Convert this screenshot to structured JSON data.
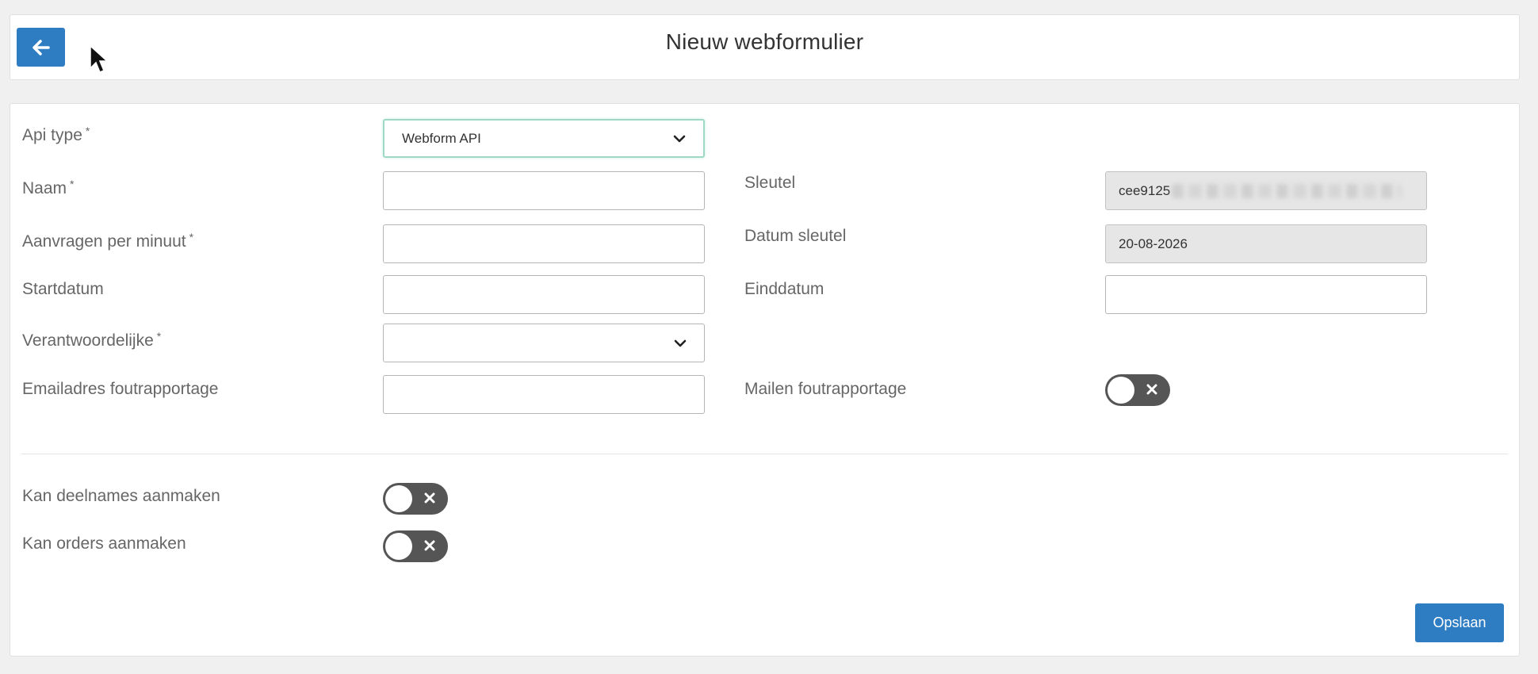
{
  "header": {
    "title": "Nieuw webformulier",
    "back_icon": "arrow-left-icon"
  },
  "form": {
    "api_type": {
      "label": "Api type",
      "required": "*",
      "value": "Webform API"
    },
    "naam": {
      "label": "Naam",
      "required": "*",
      "value": ""
    },
    "aanvragen": {
      "label": "Aanvragen per minuut",
      "required": "*",
      "value": ""
    },
    "startdatum": {
      "label": "Startdatum",
      "value": ""
    },
    "verantwoordelijke": {
      "label": "Verantwoordelijke",
      "required": "*",
      "value": ""
    },
    "emailadres": {
      "label": "Emailadres foutrapportage",
      "value": ""
    },
    "sleutel": {
      "label": "Sleutel",
      "value": "cee9125"
    },
    "datum_sleutel": {
      "label": "Datum sleutel",
      "value": "20-08-2026"
    },
    "einddatum": {
      "label": "Einddatum",
      "value": ""
    },
    "mailen": {
      "label": "Mailen foutrapportage",
      "state": "off"
    },
    "deelnames": {
      "label": "Kan deelnames aanmaken",
      "state": "off"
    },
    "orders": {
      "label": "Kan orders aanmaken",
      "state": "off"
    }
  },
  "actions": {
    "save_label": "Opslaan"
  },
  "colors": {
    "primary": "#2e7dc2",
    "toggle_off": "#555555",
    "readonly_bg": "#e6e6e6"
  }
}
